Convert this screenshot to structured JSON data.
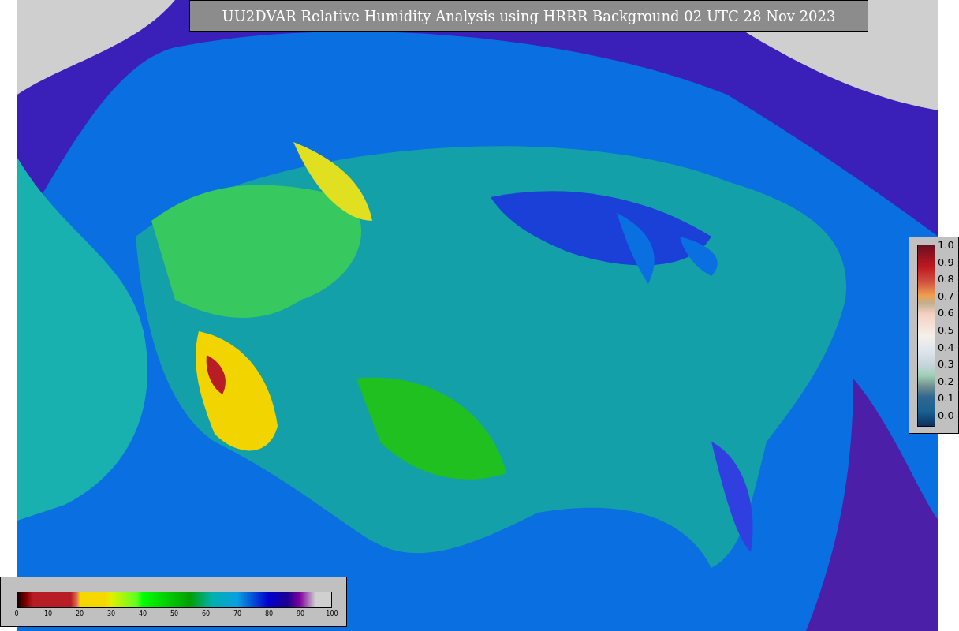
{
  "title": "UU2DVAR Relative Humidity Analysis using HRRR Background 02 UTC 28 Nov 2023",
  "humidity_legend": {
    "ticks": [
      "0",
      "10",
      "20",
      "30",
      "40",
      "50",
      "60",
      "70",
      "80",
      "90",
      "100"
    ]
  },
  "station_legend": {
    "ticks": [
      "1.0",
      "0.9",
      "0.8",
      "0.7",
      "0.6",
      "0.5",
      "0.4",
      "0.3",
      "0.2",
      "0.1",
      "0.0"
    ]
  }
}
